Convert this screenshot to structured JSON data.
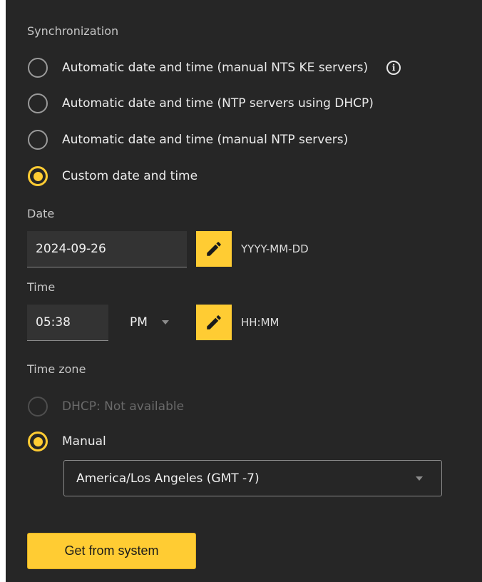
{
  "synchronization": {
    "label": "Synchronization",
    "options": [
      {
        "label": "Automatic date and time (manual NTS KE servers)",
        "selected": false,
        "info_icon": "info-icon"
      },
      {
        "label": "Automatic date and time (NTP servers using DHCP)",
        "selected": false
      },
      {
        "label": "Automatic date and time (manual NTP servers)",
        "selected": false
      },
      {
        "label": "Custom date and time",
        "selected": true
      }
    ]
  },
  "date": {
    "label": "Date",
    "value": "2024-09-26",
    "format_hint": "YYYY-MM-DD",
    "edit_icon": "pencil-icon"
  },
  "time": {
    "label": "Time",
    "value": "05:38",
    "meridiem": "PM",
    "format_hint": "HH:MM",
    "edit_icon": "pencil-icon"
  },
  "timezone": {
    "label": "Time zone",
    "options": [
      {
        "label": "DHCP: Not available",
        "selected": false,
        "disabled": true
      },
      {
        "label": "Manual",
        "selected": true
      }
    ],
    "selected_zone": "America/Los Angeles (GMT -7)"
  },
  "actions": {
    "get_from_system": "Get from system"
  },
  "colors": {
    "accent": "#ffcc33",
    "background": "#262626"
  }
}
